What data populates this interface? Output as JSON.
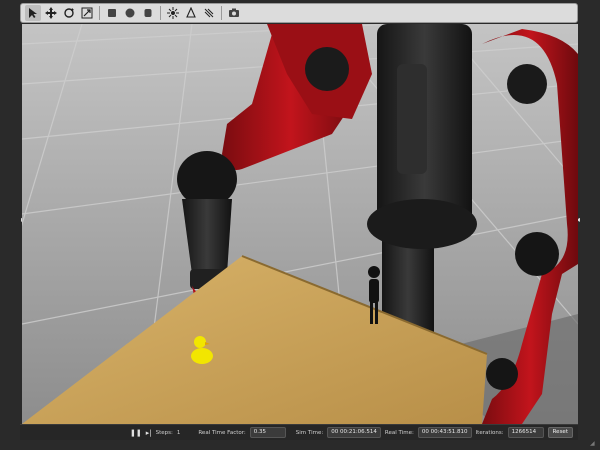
{
  "toolbar": {
    "tools": [
      {
        "name": "select-mode-icon",
        "active": true
      },
      {
        "name": "translate-mode-icon"
      },
      {
        "name": "rotate-mode-icon"
      },
      {
        "name": "scale-mode-icon"
      },
      {
        "name": "box-shape-icon"
      },
      {
        "name": "sphere-shape-icon"
      },
      {
        "name": "cylinder-shape-icon"
      },
      {
        "name": "point-light-icon"
      },
      {
        "name": "spot-light-icon"
      },
      {
        "name": "directional-light-icon"
      },
      {
        "name": "screenshot-icon"
      }
    ]
  },
  "bottombar": {
    "steps_label": "Steps:",
    "steps_value": "1",
    "rtf_label": "Real Time Factor:",
    "rtf_value": "0.35",
    "sim_time_label": "Sim Time:",
    "sim_time_value": "00 00:21:06.514",
    "real_time_label": "Real Time:",
    "real_time_value": "00 00:43:51.810",
    "iterations_label": "Iterations:",
    "iterations_value": "1266514",
    "reset_label": "Reset"
  },
  "colors": {
    "robot_red": "#b0121a",
    "table_wood": "#c8a45c",
    "floor": "#a9a9a9",
    "duck": "#f2e600"
  }
}
